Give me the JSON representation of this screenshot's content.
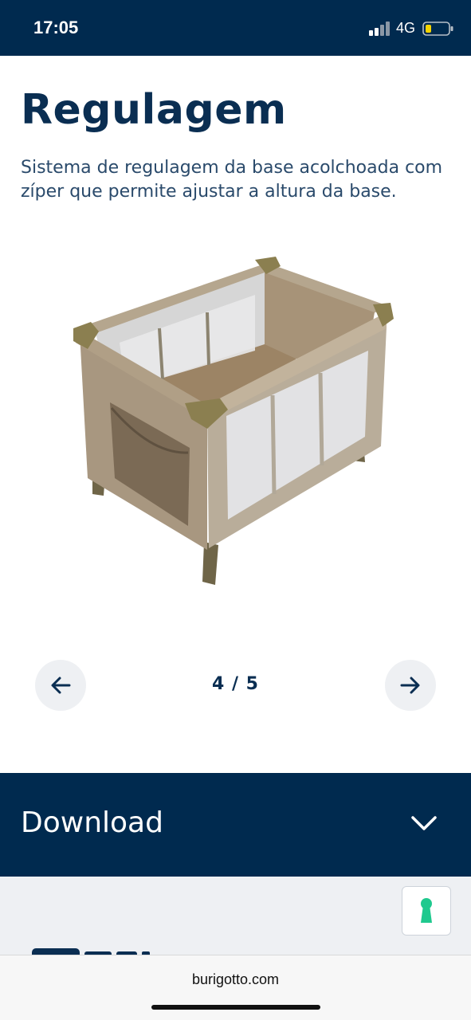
{
  "status_bar": {
    "time": "17:05",
    "network": "4G",
    "icons": [
      "signal-icon",
      "battery-icon"
    ]
  },
  "page": {
    "title": "Regulagem",
    "description": "Sistema de regulagem da base acolchoada com zíper que permite ajustar a altura da base."
  },
  "carousel": {
    "counter": "4 / 5",
    "prev_icon": "arrow-left-icon",
    "next_icon": "arrow-right-icon"
  },
  "download": {
    "label": "Download",
    "icon": "chevron-down-icon"
  },
  "browser": {
    "url": "burigotto.com"
  },
  "colors": {
    "navy": "#002a4f",
    "title": "#0a2e52",
    "button_bg": "#eef0f3",
    "help_accent": "#1fc98e"
  }
}
